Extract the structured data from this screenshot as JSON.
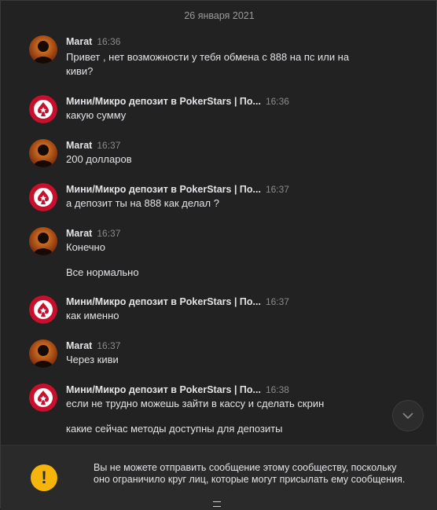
{
  "date_separator": "26 января 2021",
  "messages": [
    {
      "author": "Marat",
      "time": "16:36",
      "lines": [
        "Привет , нет возможности у тебя обмена с 888 на пс или на",
        "киви?"
      ]
    },
    {
      "author": "Мини/Микро депозит в PokerStars | По...",
      "time": "16:36",
      "lines": [
        "какую сумму"
      ]
    },
    {
      "author": "Marat",
      "time": "16:37",
      "lines": [
        "200 долларов"
      ]
    },
    {
      "author": "Мини/Микро депозит в PokerStars | По...",
      "time": "16:37",
      "lines": [
        "а депозит ты на 888 как делал ?"
      ]
    },
    {
      "author": "Marat",
      "time": "16:37",
      "lines": [
        "Конечно",
        "Все нормально"
      ]
    },
    {
      "author": "Мини/Микро депозит в PokerStars | По...",
      "time": "16:37",
      "lines": [
        "как именно"
      ]
    },
    {
      "author": "Marat",
      "time": "16:37",
      "lines": [
        "Через киви"
      ]
    },
    {
      "author": "Мини/Микро депозит в PokerStars | По...",
      "time": "16:38",
      "lines": [
        "если не трудно можешь зайти в кассу и сделать скрин",
        "какие сейчас методы доступны для депозиты"
      ]
    }
  ],
  "notice": {
    "icon": "warning-icon",
    "icon_glyph": "!",
    "text": "Вы не можете отправить сообщение этому сообществу, поскольку оно ограничило круг лиц, которые могут присылать ему сообщения."
  },
  "icons": {
    "user_avatar": "user-avatar-icon",
    "community_avatar": "pokerstars-logo-icon",
    "scroll_down": "chevron-down-icon"
  },
  "colors": {
    "background": "#222222",
    "text": "#e1e3e6",
    "muted": "#8b8b8b",
    "warning": "#f5b50a",
    "brand_red": "#c8102e"
  }
}
